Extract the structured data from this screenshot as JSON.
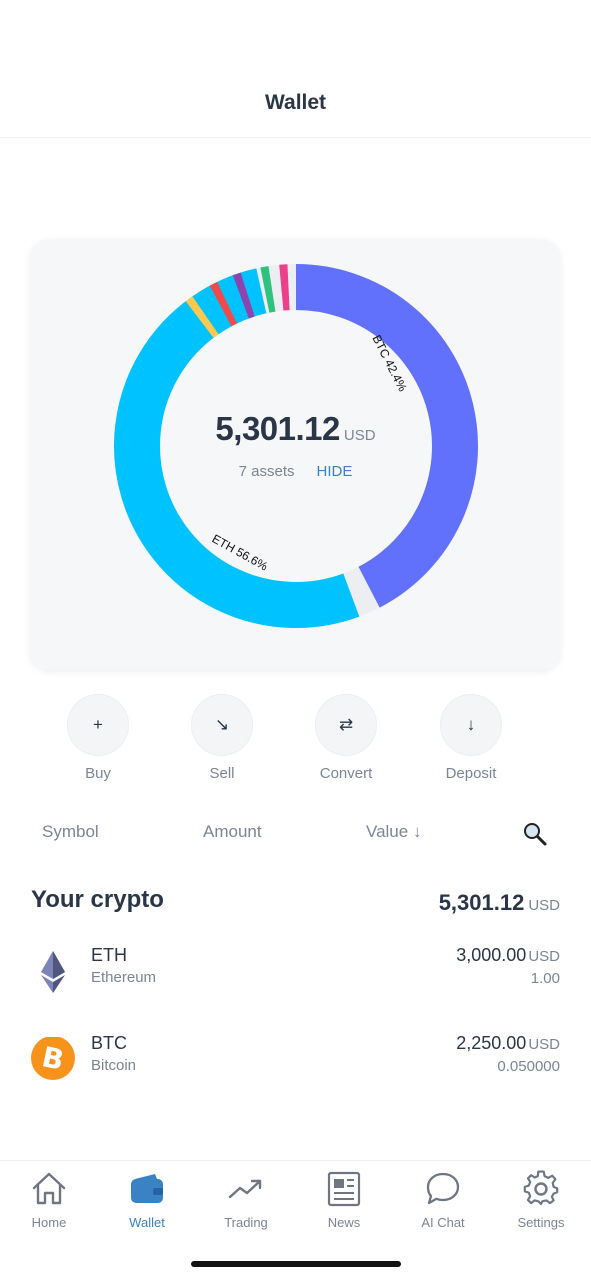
{
  "header": {
    "title": "Wallet"
  },
  "portfolio": {
    "total": "5,301.12",
    "currency": "USD",
    "assets_count": "7 assets",
    "hide_label": "HIDE",
    "chart_labels": {
      "btc": "BTC 42.4%",
      "eth": "ETH 56.6%"
    },
    "allocation": [
      {
        "symbol": "BTC",
        "percent": 42.4,
        "color": "#6271fb"
      },
      {
        "symbol": "ETH",
        "percent": 56.6,
        "color": "#00c2ff"
      }
    ],
    "minor_colors": [
      "#ffc94d",
      "#f04a4a",
      "#8e44ad",
      "#2ec27e",
      "#ec3f8c"
    ]
  },
  "actions": [
    {
      "label": "Buy",
      "icon": "plus-icon",
      "glyph": "+"
    },
    {
      "label": "Sell",
      "icon": "arrow-down-right-icon",
      "glyph": "↘"
    },
    {
      "label": "Convert",
      "icon": "swap-icon",
      "glyph": "⇄"
    },
    {
      "label": "Deposit",
      "icon": "arrow-down-icon",
      "glyph": "↓"
    }
  ],
  "sort": {
    "symbol": "Symbol",
    "amount": "Amount",
    "value": "Value ↓"
  },
  "crypto": {
    "title": "Your crypto",
    "total": "5,301.12",
    "currency": "USD",
    "assets": [
      {
        "symbol": "ETH",
        "name": "Ethereum",
        "value": "3,000.00",
        "currency": "USD",
        "quantity": "1.00",
        "icon": "ethereum-icon"
      },
      {
        "symbol": "BTC",
        "name": "Bitcoin",
        "value": "2,250.00",
        "currency": "USD",
        "quantity": "0.050000",
        "icon": "bitcoin-icon"
      }
    ]
  },
  "tabs": [
    {
      "label": "Home",
      "icon": "home-icon"
    },
    {
      "label": "Wallet",
      "icon": "wallet-icon",
      "active": true
    },
    {
      "label": "Trading",
      "icon": "trending-up-icon"
    },
    {
      "label": "News",
      "icon": "newspaper-icon"
    },
    {
      "label": "AI Chat",
      "icon": "chat-bubble-icon"
    },
    {
      "label": "Settings",
      "icon": "gear-icon"
    }
  ],
  "colors": {
    "accent": "#3b82c4",
    "text": "#2a3547",
    "muted": "#7b8593"
  }
}
